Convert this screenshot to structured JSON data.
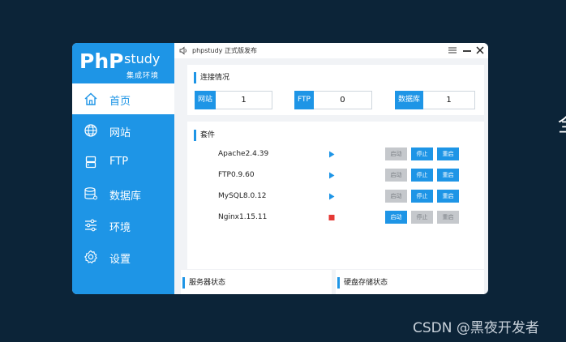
{
  "app": {
    "logo_php": "PhP",
    "logo_study": "study",
    "logo_subtitle": "集成环境",
    "title": "phpstudy 正式版发布"
  },
  "sidebar": {
    "items": [
      {
        "label": "首页",
        "icon": "home-icon",
        "active": true
      },
      {
        "label": "网站",
        "icon": "globe-icon",
        "active": false
      },
      {
        "label": "FTP",
        "icon": "server-icon",
        "active": false
      },
      {
        "label": "数据库",
        "icon": "database-icon",
        "active": false
      },
      {
        "label": "环境",
        "icon": "sliders-icon",
        "active": false
      },
      {
        "label": "设置",
        "icon": "gear-icon",
        "active": false
      }
    ]
  },
  "connection": {
    "heading": "连接情况",
    "stats": [
      {
        "label": "网站",
        "value": "1"
      },
      {
        "label": "FTP",
        "value": "0"
      },
      {
        "label": "数据库",
        "value": "1"
      }
    ]
  },
  "suite": {
    "heading": "套件",
    "buttons": {
      "start": "启动",
      "stop": "停止",
      "restart": "重启"
    },
    "services": [
      {
        "name": "Apache2.4.39",
        "status": "running"
      },
      {
        "name": "FTP0.9.60",
        "status": "running"
      },
      {
        "name": "MySQL8.0.12",
        "status": "running"
      },
      {
        "name": "Nginx1.15.11",
        "status": "stopped"
      }
    ]
  },
  "bottom": {
    "server_status": "服务器状态",
    "disk_status": "硬盘存储状态"
  },
  "edge_glyph": "全",
  "watermark": "CSDN @黑夜开发者",
  "colors": {
    "accent": "#1e95e6",
    "running": "#1e95e6",
    "stopped": "#e53935",
    "background": "#0c2438"
  }
}
